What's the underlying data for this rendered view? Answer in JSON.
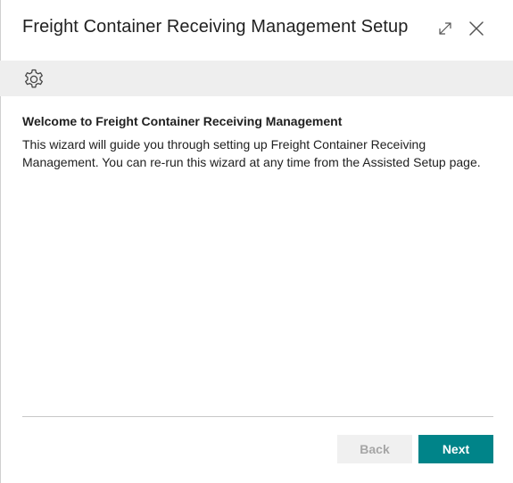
{
  "dialog": {
    "title": "Freight Container Receiving Management Setup"
  },
  "title_bar": {
    "expand_icon": "expand-diagonal-arrows-icon",
    "close_icon": "close-x-icon"
  },
  "banner": {
    "icon": "gear-icon"
  },
  "content": {
    "heading": "Welcome to Freight Container Receiving Management",
    "body": "This wizard will guide you through setting up Freight Container Receiving Management. You can re-run this wizard at any time from the Assisted Setup page."
  },
  "footer": {
    "back_label": "Back",
    "next_label": "Next",
    "back_enabled": false
  },
  "colors": {
    "accent": "#008489",
    "banner_bg": "#eeeeee",
    "disabled_bg": "#f0f0f0",
    "disabled_text": "#a6a6a6"
  }
}
